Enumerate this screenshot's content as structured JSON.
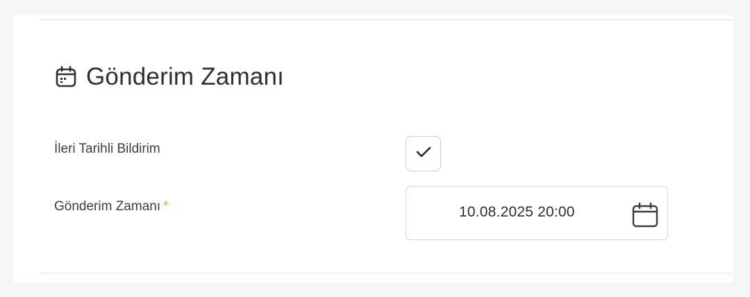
{
  "section": {
    "title": "Gönderim Zamanı",
    "icon": "calendar-icon"
  },
  "fields": {
    "scheduled": {
      "label": "İleri Tarihli Bildirim",
      "checked": true,
      "icon": "checkmark-icon"
    },
    "send_time": {
      "label": "Gönderim Zamanı",
      "required_marker": "*",
      "value": "10.08.2025 20:00",
      "icon": "calendar-icon"
    }
  },
  "colors": {
    "required": "#f5a524",
    "text": "#2e2e33",
    "border": "#d5d8de"
  }
}
